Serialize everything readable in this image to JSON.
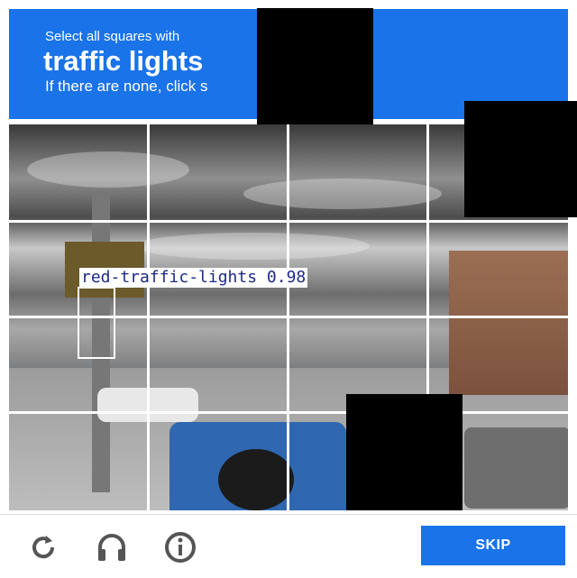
{
  "header": {
    "instruction_line1": "Select all squares with",
    "target": "traffic lights",
    "instruction_line3": "If there are none, click s"
  },
  "detection": {
    "label": "red-traffic-lights 0.98"
  },
  "footer": {
    "reload_icon": "reload-icon",
    "audio_icon": "headphones-icon",
    "info_icon": "info-icon",
    "skip_label": "SKIP"
  },
  "colors": {
    "header_bg": "#1a73e8",
    "button_bg": "#1a73e8",
    "redaction": "#000000"
  }
}
